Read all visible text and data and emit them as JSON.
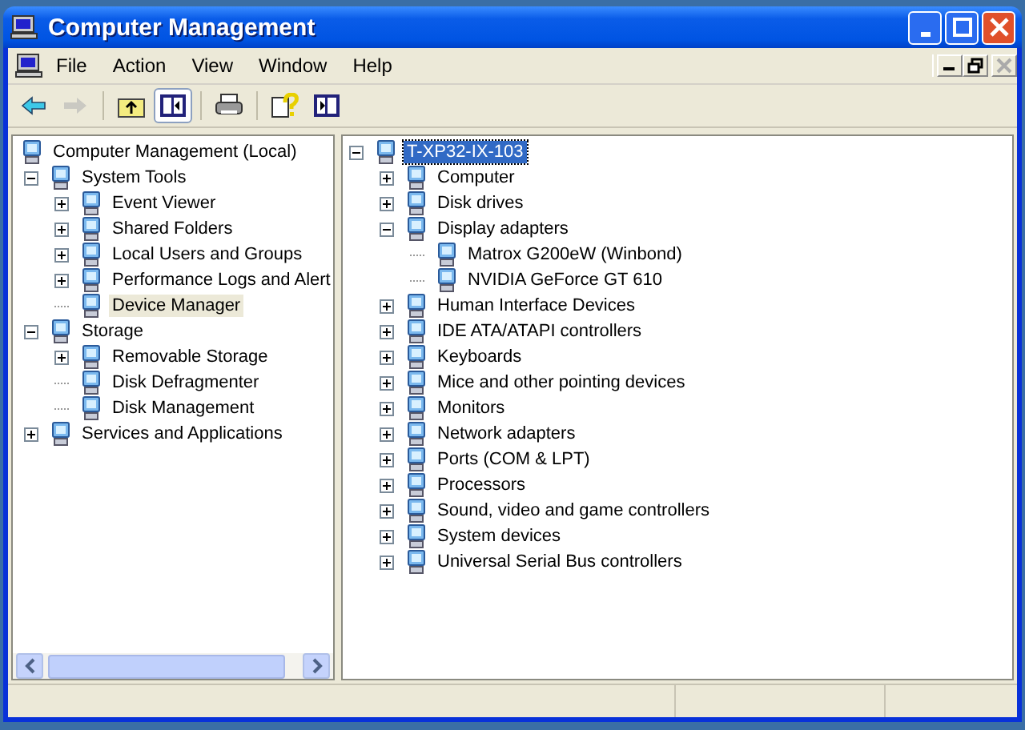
{
  "window": {
    "title": "Computer Management"
  },
  "menu": [
    {
      "label": "File"
    },
    {
      "label": "Action"
    },
    {
      "label": "View"
    },
    {
      "label": "Window"
    },
    {
      "label": "Help"
    }
  ],
  "toolbar": [
    {
      "kind": "back",
      "disabled": false,
      "pressed": false
    },
    {
      "kind": "forward",
      "disabled": true,
      "pressed": false
    },
    {
      "kind": "sep"
    },
    {
      "kind": "up",
      "disabled": false,
      "pressed": false
    },
    {
      "kind": "tree",
      "disabled": false,
      "pressed": true
    },
    {
      "kind": "sep"
    },
    {
      "kind": "print",
      "disabled": false,
      "pressed": false
    },
    {
      "kind": "sep"
    },
    {
      "kind": "help",
      "disabled": false,
      "pressed": false
    },
    {
      "kind": "action",
      "disabled": false,
      "pressed": false
    }
  ],
  "left_tree": [
    {
      "label": "Computer Management (Local)",
      "kind": "plain",
      "selected": false,
      "children": [
        {
          "label": "System Tools",
          "kind": "branch",
          "expanded": true,
          "selected": false,
          "children": [
            {
              "label": "Event Viewer",
              "kind": "branch",
              "expanded": false,
              "selected": false
            },
            {
              "label": "Shared Folders",
              "kind": "branch",
              "expanded": false,
              "selected": false
            },
            {
              "label": "Local Users and Groups",
              "kind": "branch",
              "expanded": false,
              "selected": false
            },
            {
              "label": "Performance Logs and Alert",
              "kind": "branch",
              "expanded": false,
              "selected": false
            },
            {
              "label": "Device Manager",
              "kind": "plain",
              "selected": true
            }
          ]
        },
        {
          "label": "Storage",
          "kind": "branch",
          "expanded": true,
          "selected": false,
          "children": [
            {
              "label": "Removable Storage",
              "kind": "branch",
              "expanded": false,
              "selected": false
            },
            {
              "label": "Disk Defragmenter",
              "kind": "plain",
              "selected": false
            },
            {
              "label": "Disk Management",
              "kind": "plain",
              "selected": false
            }
          ]
        },
        {
          "label": "Services and Applications",
          "kind": "branch",
          "expanded": false,
          "selected": false
        }
      ]
    }
  ],
  "right_tree": [
    {
      "label": "T-XP32-IX-103",
      "kind": "branch",
      "expanded": true,
      "selected": true,
      "children": [
        {
          "label": "Computer",
          "kind": "branch",
          "expanded": false,
          "selected": false
        },
        {
          "label": "Disk drives",
          "kind": "branch",
          "expanded": false,
          "selected": false
        },
        {
          "label": "Display adapters",
          "kind": "branch",
          "expanded": true,
          "selected": false,
          "children": [
            {
              "label": "Matrox G200eW (Winbond)",
              "kind": "plain",
              "selected": false
            },
            {
              "label": "NVIDIA GeForce GT 610",
              "kind": "plain",
              "selected": false
            }
          ]
        },
        {
          "label": "Human Interface Devices",
          "kind": "branch",
          "expanded": false,
          "selected": false
        },
        {
          "label": "IDE ATA/ATAPI controllers",
          "kind": "branch",
          "expanded": false,
          "selected": false
        },
        {
          "label": "Keyboards",
          "kind": "branch",
          "expanded": false,
          "selected": false
        },
        {
          "label": "Mice and other pointing devices",
          "kind": "branch",
          "expanded": false,
          "selected": false
        },
        {
          "label": "Monitors",
          "kind": "branch",
          "expanded": false,
          "selected": false
        },
        {
          "label": "Network adapters",
          "kind": "branch",
          "expanded": false,
          "selected": false
        },
        {
          "label": "Ports (COM & LPT)",
          "kind": "branch",
          "expanded": false,
          "selected": false
        },
        {
          "label": "Processors",
          "kind": "branch",
          "expanded": false,
          "selected": false
        },
        {
          "label": "Sound, video and game controllers",
          "kind": "branch",
          "expanded": false,
          "selected": false
        },
        {
          "label": "System devices",
          "kind": "branch",
          "expanded": false,
          "selected": false
        },
        {
          "label": "Universal Serial Bus controllers",
          "kind": "branch",
          "expanded": false,
          "selected": false
        }
      ]
    }
  ]
}
